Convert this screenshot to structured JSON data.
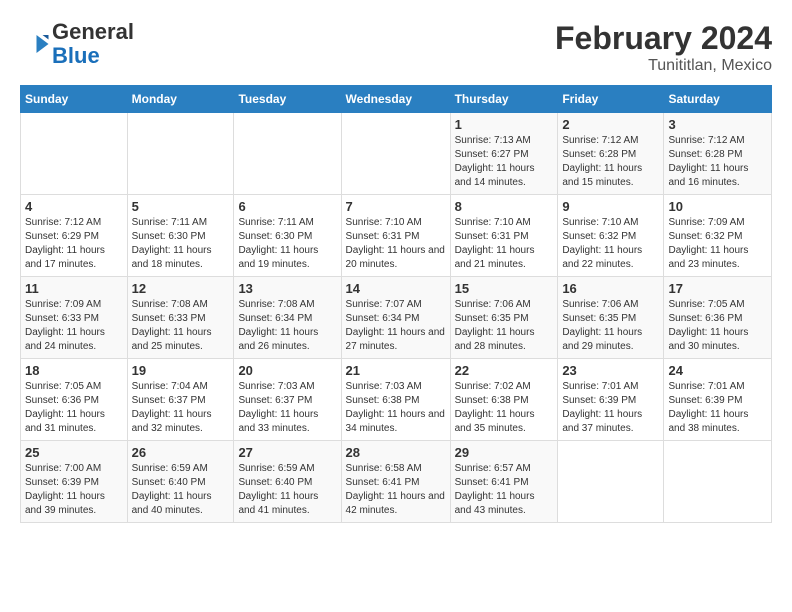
{
  "logo": {
    "text_general": "General",
    "text_blue": "Blue"
  },
  "title": "February 2024",
  "subtitle": "Tunititlan, Mexico",
  "days_of_week": [
    "Sunday",
    "Monday",
    "Tuesday",
    "Wednesday",
    "Thursday",
    "Friday",
    "Saturday"
  ],
  "weeks": [
    [
      {
        "day": "",
        "info": ""
      },
      {
        "day": "",
        "info": ""
      },
      {
        "day": "",
        "info": ""
      },
      {
        "day": "",
        "info": ""
      },
      {
        "day": "1",
        "info": "Sunrise: 7:13 AM\nSunset: 6:27 PM\nDaylight: 11 hours and 14 minutes."
      },
      {
        "day": "2",
        "info": "Sunrise: 7:12 AM\nSunset: 6:28 PM\nDaylight: 11 hours and 15 minutes."
      },
      {
        "day": "3",
        "info": "Sunrise: 7:12 AM\nSunset: 6:28 PM\nDaylight: 11 hours and 16 minutes."
      }
    ],
    [
      {
        "day": "4",
        "info": "Sunrise: 7:12 AM\nSunset: 6:29 PM\nDaylight: 11 hours and 17 minutes."
      },
      {
        "day": "5",
        "info": "Sunrise: 7:11 AM\nSunset: 6:30 PM\nDaylight: 11 hours and 18 minutes."
      },
      {
        "day": "6",
        "info": "Sunrise: 7:11 AM\nSunset: 6:30 PM\nDaylight: 11 hours and 19 minutes."
      },
      {
        "day": "7",
        "info": "Sunrise: 7:10 AM\nSunset: 6:31 PM\nDaylight: 11 hours and 20 minutes."
      },
      {
        "day": "8",
        "info": "Sunrise: 7:10 AM\nSunset: 6:31 PM\nDaylight: 11 hours and 21 minutes."
      },
      {
        "day": "9",
        "info": "Sunrise: 7:10 AM\nSunset: 6:32 PM\nDaylight: 11 hours and 22 minutes."
      },
      {
        "day": "10",
        "info": "Sunrise: 7:09 AM\nSunset: 6:32 PM\nDaylight: 11 hours and 23 minutes."
      }
    ],
    [
      {
        "day": "11",
        "info": "Sunrise: 7:09 AM\nSunset: 6:33 PM\nDaylight: 11 hours and 24 minutes."
      },
      {
        "day": "12",
        "info": "Sunrise: 7:08 AM\nSunset: 6:33 PM\nDaylight: 11 hours and 25 minutes."
      },
      {
        "day": "13",
        "info": "Sunrise: 7:08 AM\nSunset: 6:34 PM\nDaylight: 11 hours and 26 minutes."
      },
      {
        "day": "14",
        "info": "Sunrise: 7:07 AM\nSunset: 6:34 PM\nDaylight: 11 hours and 27 minutes."
      },
      {
        "day": "15",
        "info": "Sunrise: 7:06 AM\nSunset: 6:35 PM\nDaylight: 11 hours and 28 minutes."
      },
      {
        "day": "16",
        "info": "Sunrise: 7:06 AM\nSunset: 6:35 PM\nDaylight: 11 hours and 29 minutes."
      },
      {
        "day": "17",
        "info": "Sunrise: 7:05 AM\nSunset: 6:36 PM\nDaylight: 11 hours and 30 minutes."
      }
    ],
    [
      {
        "day": "18",
        "info": "Sunrise: 7:05 AM\nSunset: 6:36 PM\nDaylight: 11 hours and 31 minutes."
      },
      {
        "day": "19",
        "info": "Sunrise: 7:04 AM\nSunset: 6:37 PM\nDaylight: 11 hours and 32 minutes."
      },
      {
        "day": "20",
        "info": "Sunrise: 7:03 AM\nSunset: 6:37 PM\nDaylight: 11 hours and 33 minutes."
      },
      {
        "day": "21",
        "info": "Sunrise: 7:03 AM\nSunset: 6:38 PM\nDaylight: 11 hours and 34 minutes."
      },
      {
        "day": "22",
        "info": "Sunrise: 7:02 AM\nSunset: 6:38 PM\nDaylight: 11 hours and 35 minutes."
      },
      {
        "day": "23",
        "info": "Sunrise: 7:01 AM\nSunset: 6:39 PM\nDaylight: 11 hours and 37 minutes."
      },
      {
        "day": "24",
        "info": "Sunrise: 7:01 AM\nSunset: 6:39 PM\nDaylight: 11 hours and 38 minutes."
      }
    ],
    [
      {
        "day": "25",
        "info": "Sunrise: 7:00 AM\nSunset: 6:39 PM\nDaylight: 11 hours and 39 minutes."
      },
      {
        "day": "26",
        "info": "Sunrise: 6:59 AM\nSunset: 6:40 PM\nDaylight: 11 hours and 40 minutes."
      },
      {
        "day": "27",
        "info": "Sunrise: 6:59 AM\nSunset: 6:40 PM\nDaylight: 11 hours and 41 minutes."
      },
      {
        "day": "28",
        "info": "Sunrise: 6:58 AM\nSunset: 6:41 PM\nDaylight: 11 hours and 42 minutes."
      },
      {
        "day": "29",
        "info": "Sunrise: 6:57 AM\nSunset: 6:41 PM\nDaylight: 11 hours and 43 minutes."
      },
      {
        "day": "",
        "info": ""
      },
      {
        "day": "",
        "info": ""
      }
    ]
  ]
}
